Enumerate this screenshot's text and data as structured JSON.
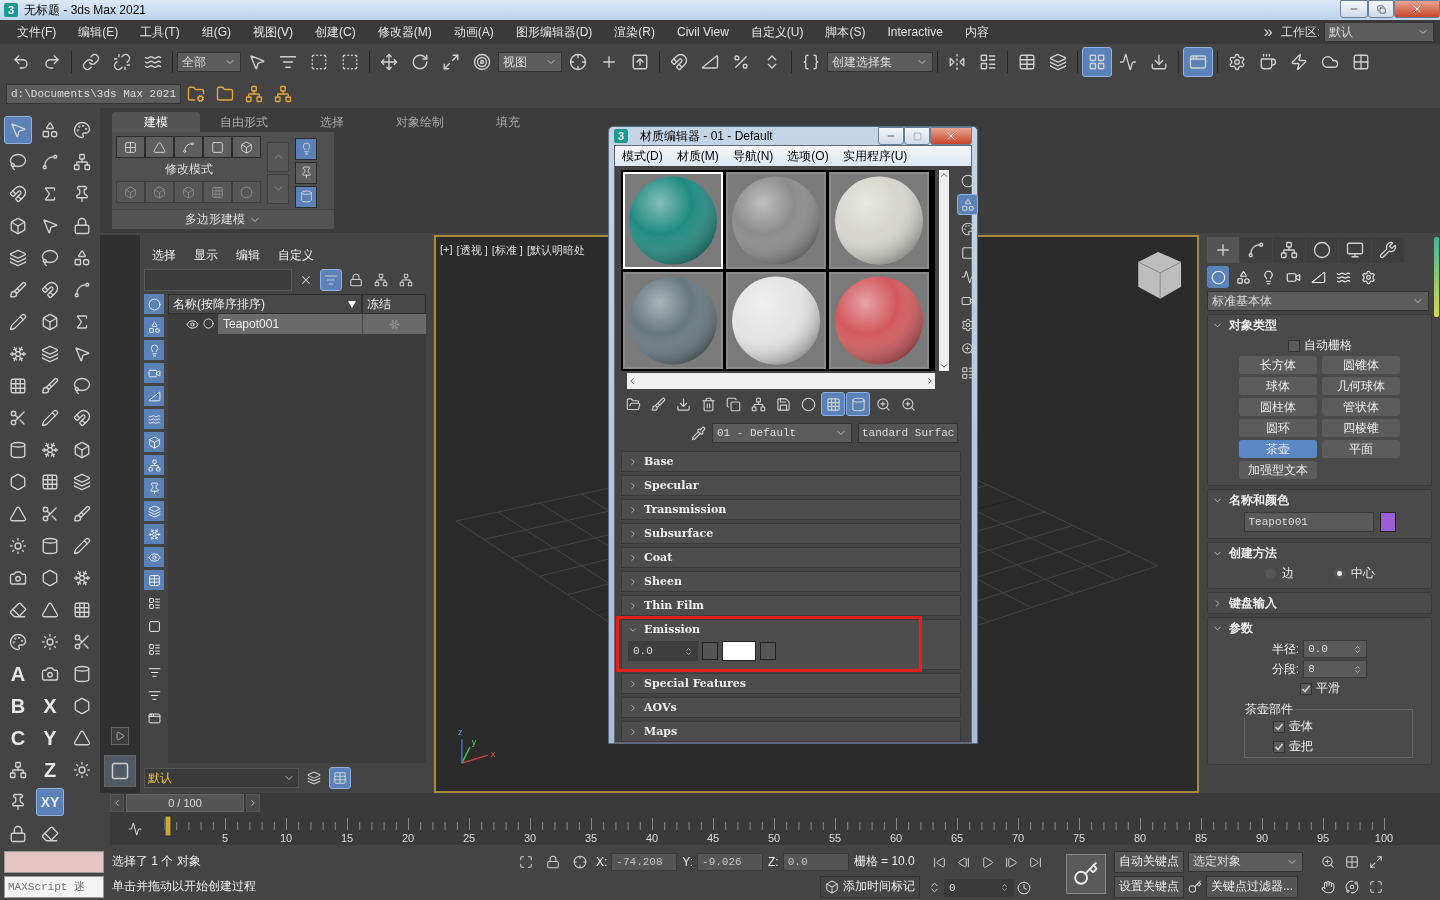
{
  "window": {
    "icon_text": "3",
    "title": "无标题 - 3ds Max 2021"
  },
  "menu": [
    {
      "label": "文件(F)"
    },
    {
      "label": "编辑(E)"
    },
    {
      "label": "工具(T)"
    },
    {
      "label": "组(G)"
    },
    {
      "label": "视图(V)"
    },
    {
      "label": "创建(C)"
    },
    {
      "label": "修改器(M)"
    },
    {
      "label": "动画(A)"
    },
    {
      "label": "图形编辑器(D)"
    },
    {
      "label": "渲染(R)"
    },
    {
      "label": "Civil View"
    },
    {
      "label": "自定义(U)"
    },
    {
      "label": "脚本(S)"
    },
    {
      "label": "Interactive"
    },
    {
      "label": "内容"
    }
  ],
  "menu_overflow": "»",
  "workspace": {
    "label": "工作区:",
    "value": "默认"
  },
  "main_toolbar": [
    {
      "kind": "icon",
      "on": false
    },
    {
      "kind": "icon",
      "on": false
    },
    {
      "kind": "separator"
    },
    {
      "kind": "icon",
      "on": false
    },
    {
      "kind": "icon",
      "on": false
    },
    {
      "kind": "icon",
      "on": false
    },
    {
      "kind": "separator"
    },
    {
      "kind": "dropdown",
      "value": "全部"
    },
    {
      "kind": "icon",
      "on": false
    },
    {
      "kind": "icon",
      "on": false
    },
    {
      "kind": "icon",
      "on": false
    },
    {
      "kind": "icon",
      "on": false
    },
    {
      "kind": "separator"
    },
    {
      "kind": "icon",
      "on": false
    },
    {
      "kind": "icon",
      "on": false
    },
    {
      "kind": "icon",
      "on": false
    },
    {
      "kind": "icon",
      "on": false
    },
    {
      "kind": "dropdown",
      "value": "视图"
    },
    {
      "kind": "icon",
      "on": false
    },
    {
      "kind": "icon",
      "on": false
    },
    {
      "kind": "icon",
      "on": false
    },
    {
      "kind": "separator"
    },
    {
      "kind": "icon",
      "on": false
    },
    {
      "kind": "icon",
      "on": false
    },
    {
      "kind": "icon",
      "on": false
    },
    {
      "kind": "icon",
      "on": false
    },
    {
      "kind": "separator"
    },
    {
      "kind": "icon",
      "on": false
    },
    {
      "kind": "dropdown",
      "value": "创建选择集"
    },
    {
      "kind": "separator"
    },
    {
      "kind": "icon",
      "on": false
    },
    {
      "kind": "icon",
      "on": false
    },
    {
      "kind": "separator"
    },
    {
      "kind": "icon",
      "on": false
    },
    {
      "kind": "icon",
      "on": false
    },
    {
      "kind": "separator"
    },
    {
      "kind": "icon",
      "on": true
    },
    {
      "kind": "icon",
      "on": false
    },
    {
      "kind": "icon",
      "on": false
    },
    {
      "kind": "separator"
    },
    {
      "kind": "icon",
      "on": true
    },
    {
      "kind": "separator"
    },
    {
      "kind": "icon",
      "on": false
    },
    {
      "kind": "icon",
      "on": false
    },
    {
      "kind": "icon",
      "on": false
    },
    {
      "kind": "icon",
      "on": false
    },
    {
      "kind": "icon",
      "on": false
    }
  ],
  "path_toolbar": {
    "path": "d:\\Documents\\3ds Max 2021",
    "buttons": [
      {
        "on": false
      },
      {
        "on": false
      },
      {
        "on": false
      },
      {
        "on": false
      }
    ]
  },
  "left_tools": [
    {
      "tools": [
        {
          "kind": "icon",
          "on": true
        },
        {
          "kind": "icon",
          "on": false
        },
        {
          "kind": "icon",
          "on": false
        },
        {
          "kind": "icon",
          "on": false
        },
        {
          "kind": "icon",
          "on": false
        },
        {
          "kind": "icon",
          "on": false
        },
        {
          "kind": "icon",
          "on": false
        },
        {
          "kind": "icon",
          "on": false
        },
        {
          "kind": "icon",
          "on": false
        },
        {
          "kind": "icon",
          "on": false
        },
        {
          "kind": "icon",
          "on": false
        },
        {
          "kind": "icon",
          "on": false
        },
        {
          "kind": "icon",
          "on": false
        },
        {
          "kind": "icon",
          "on": false
        },
        {
          "kind": "icon",
          "on": false
        },
        {
          "kind": "icon",
          "on": false
        },
        {
          "kind": "icon",
          "on": false
        },
        {
          "kind": "letter",
          "text": "A",
          "on": false
        },
        {
          "kind": "letter",
          "text": "B",
          "on": false
        },
        {
          "kind": "letter",
          "text": "C",
          "on": false
        },
        {
          "kind": "icon",
          "on": false
        },
        {
          "kind": "icon",
          "on": false
        },
        {
          "kind": "icon",
          "on": false
        }
      ]
    },
    {
      "tools": [
        {
          "kind": "icon",
          "on": false
        },
        {
          "kind": "icon",
          "on": false
        },
        {
          "kind": "icon",
          "on": false
        },
        {
          "kind": "icon",
          "on": false
        },
        {
          "kind": "icon",
          "on": false
        },
        {
          "kind": "icon",
          "on": false
        },
        {
          "kind": "icon",
          "on": false
        },
        {
          "kind": "icon",
          "on": false
        },
        {
          "kind": "icon",
          "on": false
        },
        {
          "kind": "icon",
          "on": false
        },
        {
          "kind": "icon",
          "on": false
        },
        {
          "kind": "icon",
          "on": false
        },
        {
          "kind": "icon",
          "on": false
        },
        {
          "kind": "icon",
          "on": false
        },
        {
          "kind": "icon",
          "on": false
        },
        {
          "kind": "icon",
          "on": false
        },
        {
          "kind": "icon",
          "on": false
        },
        {
          "kind": "icon",
          "on": false
        },
        {
          "kind": "letter",
          "text": "X",
          "on": false
        },
        {
          "kind": "letter",
          "text": "Y",
          "on": false
        },
        {
          "kind": "letter",
          "text": "Z",
          "on": false
        },
        {
          "kind": "letter",
          "text": "XY",
          "on": true
        },
        {
          "kind": "icon",
          "on": false
        }
      ]
    },
    {
      "tools": [
        {
          "kind": "icon",
          "on": false
        },
        {
          "kind": "icon",
          "on": false
        },
        {
          "kind": "icon",
          "on": false
        },
        {
          "kind": "icon",
          "on": false
        },
        {
          "kind": "icon",
          "on": false
        },
        {
          "kind": "icon",
          "on": false
        },
        {
          "kind": "icon",
          "on": false
        },
        {
          "kind": "icon",
          "on": false
        },
        {
          "kind": "icon",
          "on": false
        },
        {
          "kind": "icon",
          "on": false
        },
        {
          "kind": "icon",
          "on": false
        },
        {
          "kind": "icon",
          "on": false
        },
        {
          "kind": "icon",
          "on": false
        },
        {
          "kind": "icon",
          "on": false
        },
        {
          "kind": "icon",
          "on": false
        },
        {
          "kind": "icon",
          "on": false
        },
        {
          "kind": "icon",
          "on": false
        },
        {
          "kind": "icon",
          "on": false
        },
        {
          "kind": "icon",
          "on": false
        },
        {
          "kind": "icon",
          "on": false
        },
        {
          "kind": "icon",
          "on": false
        }
      ]
    }
  ],
  "ribbon": {
    "tabs": [
      {
        "label": "建模",
        "selected": true
      },
      {
        "label": "自由形式",
        "selected": false
      },
      {
        "label": "选择",
        "selected": false
      },
      {
        "label": "对象绘制",
        "selected": false
      },
      {
        "label": "填充",
        "selected": false
      }
    ],
    "sub_objects": [
      {
        "on": false
      },
      {
        "on": false
      },
      {
        "on": false
      },
      {
        "on": false
      },
      {
        "on": false
      }
    ],
    "group_label": "修改模式",
    "tools": [
      {
        "disabled": true
      },
      {
        "disabled": true
      },
      {
        "disabled": true
      },
      {
        "disabled": true
      },
      {
        "disabled": true
      }
    ],
    "stack_buttons": [
      {
        "disabled": true
      },
      {
        "disabled": true
      }
    ],
    "toggles": [
      {
        "on": true
      },
      {
        "on": false
      },
      {
        "on": true
      }
    ],
    "panel_title": "多边形建模"
  },
  "scene_explorer": {
    "menu": [
      {
        "label": "选择"
      },
      {
        "label": "显示"
      },
      {
        "label": "编辑"
      },
      {
        "label": "自定义"
      }
    ],
    "toolbar": [
      {
        "on": false
      },
      {
        "on": true
      },
      {
        "on": false
      },
      {
        "on": false
      },
      {
        "on": false
      }
    ],
    "filters": [
      {
        "on": true
      },
      {
        "on": true
      },
      {
        "on": true
      },
      {
        "on": true
      },
      {
        "on": true
      },
      {
        "on": true
      },
      {
        "on": true
      },
      {
        "on": true
      },
      {
        "on": true
      },
      {
        "on": true
      },
      {
        "on": true
      },
      {
        "on": true
      },
      {
        "on": true
      },
      {
        "on": false
      },
      {
        "on": false
      },
      {
        "on": false
      },
      {
        "on": false
      },
      {
        "on": false
      },
      {
        "on": false
      }
    ],
    "columns": [
      {
        "label": "名称(按降序排序)",
        "sorted": true
      },
      {
        "label": "冻结",
        "sorted": false
      }
    ],
    "rows": [
      {
        "name": "Teapot001",
        "visible": true,
        "selected": true,
        "frozen": false
      }
    ],
    "layer": "默认",
    "bottom_buttons": [
      {
        "on": false
      },
      {
        "on": true
      }
    ]
  },
  "viewport": {
    "labels": [
      "[+]",
      "[透视 ]",
      "[标准 ]",
      "[默认明暗处"
    ],
    "active": true,
    "axes": [
      "z",
      "y",
      "x"
    ]
  },
  "material_editor": {
    "icon_text": "3",
    "title": "材质编辑器 - 01 - Default",
    "menu": [
      {
        "label": "模式(D)"
      },
      {
        "label": "材质(M)"
      },
      {
        "label": "导航(N)"
      },
      {
        "label": "选项(O)"
      },
      {
        "label": "实用程序(U)"
      }
    ],
    "slots": [
      {
        "color": "#1f8a82",
        "selected": true
      },
      {
        "color": "#8c8c8c",
        "selected": false
      },
      {
        "color": "#d6d6cf",
        "selected": false
      },
      {
        "color": "#66777e",
        "selected": false
      },
      {
        "color": "#e4e4e4",
        "selected": false
      },
      {
        "color": "#d2585d",
        "selected": false
      }
    ],
    "side_buttons": [
      {
        "on": false
      },
      {
        "on": true
      },
      {
        "on": false
      },
      {
        "on": false
      },
      {
        "on": false
      },
      {
        "on": false
      },
      {
        "on": false
      },
      {
        "on": false
      },
      {
        "on": false
      }
    ],
    "toolbar": [
      {
        "on": false
      },
      {
        "on": false
      },
      {
        "on": false
      },
      {
        "on": false
      },
      {
        "on": false
      },
      {
        "on": false
      },
      {
        "on": false
      },
      {
        "on": false
      },
      {
        "on": true
      },
      {
        "on": true
      },
      {
        "on": false
      },
      {
        "on": false
      }
    ],
    "material_name": "01 - Default",
    "material_type": "tandard Surfac",
    "rollouts": [
      {
        "title": "Base",
        "expanded": false,
        "highlighted": false
      },
      {
        "title": "Specular",
        "expanded": false,
        "highlighted": false
      },
      {
        "title": "Transmission",
        "expanded": false,
        "highlighted": false
      },
      {
        "title": "Subsurface",
        "expanded": false,
        "highlighted": false
      },
      {
        "title": "Coat",
        "expanded": false,
        "highlighted": false
      },
      {
        "title": "Sheen",
        "expanded": false,
        "highlighted": false
      },
      {
        "title": "Thin Film",
        "expanded": false,
        "highlighted": false
      },
      {
        "title": "Emission",
        "expanded": true,
        "highlighted": true,
        "weight": "0.0"
      },
      {
        "title": "Special Features",
        "expanded": false,
        "highlighted": false
      },
      {
        "title": "AOVs",
        "expanded": false,
        "highlighted": false
      },
      {
        "title": "Maps",
        "expanded": false,
        "highlighted": false
      }
    ]
  },
  "command_panel": {
    "tabs": [
      {
        "selected": true
      },
      {
        "selected": false
      },
      {
        "selected": false
      },
      {
        "selected": false
      },
      {
        "selected": false
      },
      {
        "selected": false
      }
    ],
    "categories": [
      {
        "selected": true
      },
      {
        "selected": false
      },
      {
        "selected": false
      },
      {
        "selected": false
      },
      {
        "selected": false
      },
      {
        "selected": false
      },
      {
        "selected": false
      }
    ],
    "category_value": "标准基本体",
    "object_type": {
      "title": "对象类型",
      "expanded": true,
      "autogrid": {
        "label": "自动栅格",
        "checked": false
      },
      "buttons": [
        {
          "label": "长方体",
          "selected": false
        },
        {
          "label": "圆锥体",
          "selected": false
        },
        {
          "label": "球体",
          "selected": false
        },
        {
          "label": "几何球体",
          "selected": false
        },
        {
          "label": "圆柱体",
          "selected": false
        },
        {
          "label": "管状体",
          "selected": false
        },
        {
          "label": "圆环",
          "selected": false
        },
        {
          "label": "四棱锥",
          "selected": false
        },
        {
          "label": "茶壶",
          "selected": true
        },
        {
          "label": "平面",
          "selected": false
        },
        {
          "label": "加强型文本",
          "selected": false
        }
      ]
    },
    "name_color": {
      "title": "名称和颜色",
      "expanded": true,
      "name": "Teapot001",
      "color": "#9b5fd6"
    },
    "creation_method": {
      "title": "创建方法",
      "expanded": true,
      "options": [
        {
          "label": "边",
          "selected": false
        },
        {
          "label": "中心",
          "selected": true
        }
      ]
    },
    "keyboard_entry": {
      "title": "键盘输入",
      "expanded": false
    },
    "parameters": {
      "title": "参数",
      "expanded": true,
      "fields": [
        {
          "label": "半径:",
          "value": "0.0"
        },
        {
          "label": "分段:",
          "value": "8"
        }
      ],
      "smooth": {
        "label": "平滑",
        "checked": true
      },
      "group_title": "茶壶部件",
      "parts": [
        {
          "label": "壶体",
          "checked": true
        },
        {
          "label": "壶把",
          "checked": true
        }
      ]
    }
  },
  "timeline": {
    "time_slider": {
      "label": "0 / 100",
      "level": 0
    },
    "labels": [
      "5",
      "10",
      "15",
      "20",
      "25",
      "30",
      "35",
      "40",
      "45",
      "50",
      "55",
      "60",
      "65",
      "70",
      "75",
      "80",
      "85",
      "90",
      "95",
      "100"
    ]
  },
  "status": {
    "listener": "MAXScript 迷",
    "prompt": "选择了 1 个 对象",
    "hint": "单击并拖动以开始创建过程",
    "coords": [
      {
        "label": "X:",
        "value": "-74.208"
      },
      {
        "label": "Y:",
        "value": "-9.026"
      },
      {
        "label": "Z:",
        "value": "0.0"
      }
    ],
    "grid": "栅格 = 10.0",
    "add_time_tag": "添加时间标记",
    "frame": "0",
    "auto_key": "自动关键点",
    "key_set": "选定对象",
    "set_key": "设置关键点",
    "key_filters": "关键点过滤器..."
  }
}
